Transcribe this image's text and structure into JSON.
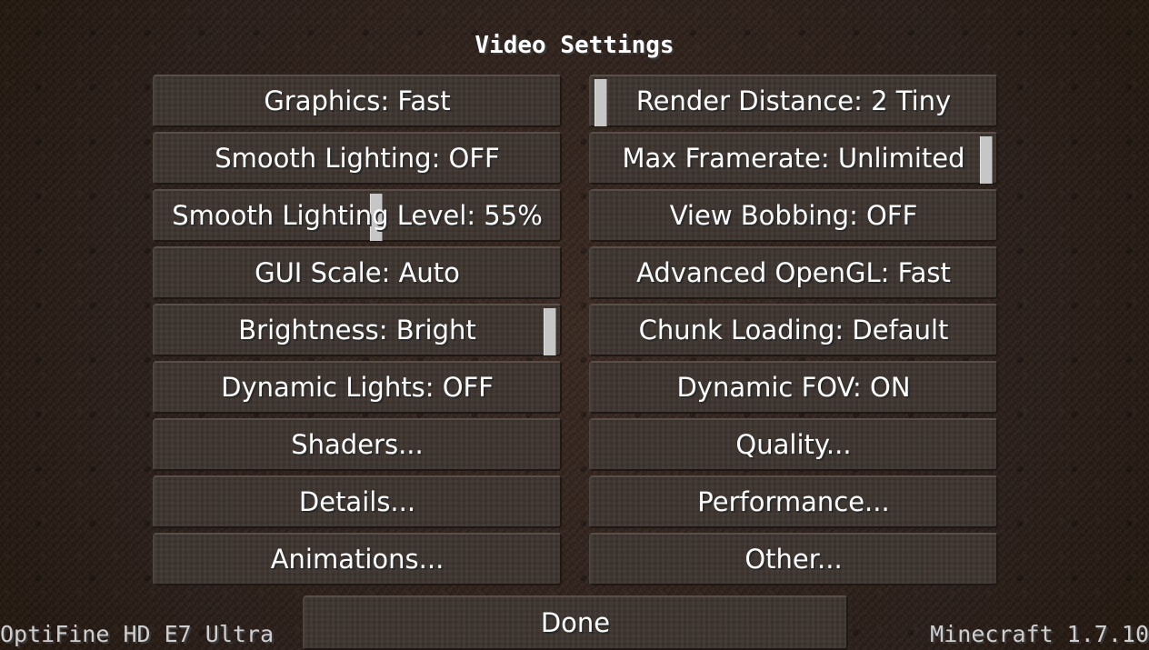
{
  "screen": {
    "title": "Video Settings"
  },
  "left_column": [
    {
      "label": "Graphics: Fast",
      "type": "button"
    },
    {
      "label": "Smooth Lighting: OFF",
      "type": "button"
    },
    {
      "label": "Smooth Lighting Level: 55%",
      "type": "slider",
      "value_fraction": 0.55
    },
    {
      "label": "GUI Scale: Auto",
      "type": "button"
    },
    {
      "label": "Brightness: Bright",
      "type": "slider",
      "value_fraction": 1.0
    },
    {
      "label": "Dynamic Lights: OFF",
      "type": "button"
    },
    {
      "label": "Shaders...",
      "type": "button"
    },
    {
      "label": "Details...",
      "type": "button"
    },
    {
      "label": "Animations...",
      "type": "button"
    }
  ],
  "right_column": [
    {
      "label": "Render Distance: 2 Tiny",
      "type": "slider",
      "value_fraction": 0.0
    },
    {
      "label": "Max Framerate: Unlimited",
      "type": "slider",
      "value_fraction": 1.0
    },
    {
      "label": "View Bobbing: OFF",
      "type": "button"
    },
    {
      "label": "Advanced OpenGL: Fast",
      "type": "button"
    },
    {
      "label": "Chunk Loading: Default",
      "type": "button"
    },
    {
      "label": "Dynamic FOV: ON",
      "type": "button"
    },
    {
      "label": "Quality...",
      "type": "button"
    },
    {
      "label": "Performance...",
      "type": "button"
    },
    {
      "label": "Other...",
      "type": "button"
    }
  ],
  "done_button": {
    "label": "Done"
  },
  "footer": {
    "left": "OptiFine HD E7 Ultra",
    "right": "Minecraft 1.7.10"
  }
}
